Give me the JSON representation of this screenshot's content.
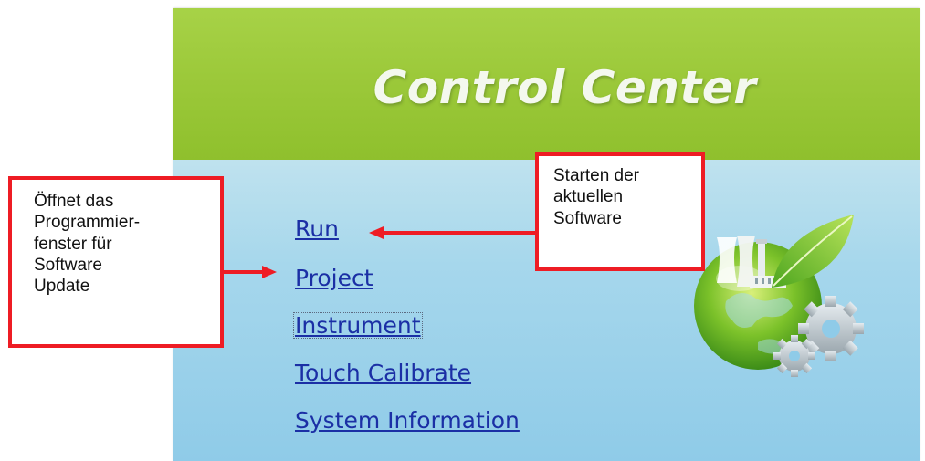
{
  "app": {
    "title": "Control Center"
  },
  "menu": {
    "items": [
      {
        "label": "Run"
      },
      {
        "label": "Project"
      },
      {
        "label": "Instrument"
      },
      {
        "label": "Touch Calibrate"
      },
      {
        "label": "System Information"
      }
    ]
  },
  "annotations": {
    "left": {
      "lines": [
        "Öffnet das",
        "Programmier-",
        "fenster für",
        "Software",
        "Update"
      ]
    },
    "right": {
      "lines": [
        "Starten der",
        "aktuellen",
        "Software"
      ]
    }
  },
  "colors": {
    "header_green": "#9cc93a",
    "body_blue": "#a6d7ec",
    "link_blue": "#1b2fa5",
    "callout_red": "#ee1c24"
  },
  "icons": {
    "logo": "eco-globe-factory-gear-icon"
  }
}
